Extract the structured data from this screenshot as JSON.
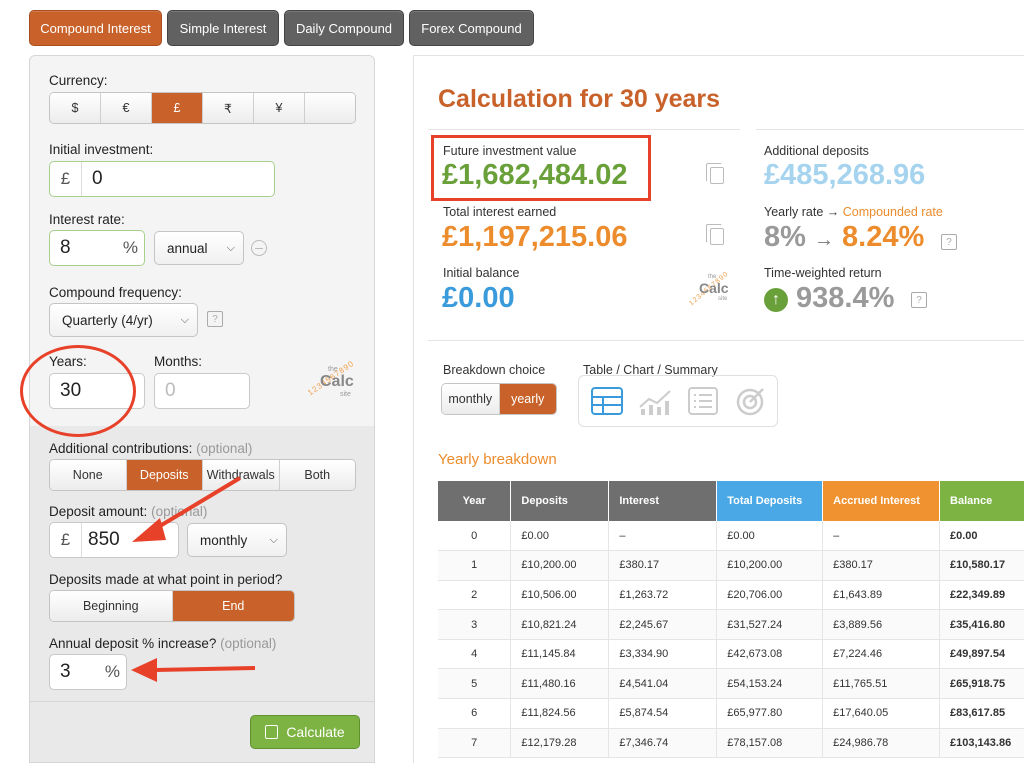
{
  "tabs": [
    {
      "label": "Compound Interest",
      "active": true
    },
    {
      "label": "Simple Interest",
      "active": false
    },
    {
      "label": "Daily Compound",
      "active": false
    },
    {
      "label": "Forex Compound",
      "active": false
    }
  ],
  "form": {
    "currency_label": "Currency:",
    "currencies": [
      "$",
      "€",
      "£",
      "₹",
      "¥",
      ""
    ],
    "currency_selected": "£",
    "initial_label": "Initial investment:",
    "initial_prefix": "£",
    "initial_value": "0",
    "rate_label": "Interest rate:",
    "rate_value": "8",
    "rate_unit": "%",
    "rate_period": "annual",
    "freq_label": "Compound frequency:",
    "freq_value": "Quarterly (4/yr)",
    "years_label": "Years:",
    "years_value": "30",
    "months_label": "Months:",
    "months_placeholder": "0",
    "contrib_label": "Additional contributions:",
    "contrib_optional": "(optional)",
    "contrib_options": [
      "None",
      "Deposits",
      "Withdrawals",
      "Both"
    ],
    "contrib_selected": "Deposits",
    "deposit_label": "Deposit amount:",
    "deposit_optional": "(optional)",
    "deposit_prefix": "£",
    "deposit_value": "850",
    "deposit_period": "monthly",
    "timing_label": "Deposits made at what point in period?",
    "timing_options": [
      "Beginning",
      "End"
    ],
    "timing_selected": "End",
    "increase_label": "Annual deposit % increase?",
    "increase_optional": "(optional)",
    "increase_value": "3",
    "increase_unit": "%",
    "calculate_label": "Calculate",
    "qmark": "?"
  },
  "logo": {
    "the": "the",
    "calc": "Calc",
    "site": "site",
    "digits": "1234567890"
  },
  "results": {
    "title": "Calculation for 30 years",
    "future_label": "Future investment value",
    "future_value": "£1,682,484.02",
    "interest_label": "Total interest earned",
    "interest_value": "£1,197,215.06",
    "initial_label": "Initial balance",
    "initial_value": "£0.00",
    "deposits_label": "Additional deposits",
    "deposits_value": "£485,268.96",
    "yearly_rate_label": "Yearly rate →",
    "compounded_label": "Compounded rate",
    "yearly_rate_value": "8%",
    "arrow": "→",
    "compounded_value": "8.24%",
    "twr_label": "Time-weighted return",
    "twr_value": "938.4%",
    "qmark": "?"
  },
  "breakdown": {
    "choice_label": "Breakdown choice",
    "options": [
      "monthly",
      "yearly"
    ],
    "selected": "yearly",
    "view_label": "Table / Chart / Summary",
    "section_title": "Yearly breakdown"
  },
  "table": {
    "headers": [
      "Year",
      "Deposits",
      "Interest",
      "Total Deposits",
      "Accrued Interest",
      "Balance"
    ],
    "header_colors": [
      "#6f6f6f",
      "#6f6f6f",
      "#6f6f6f",
      "#4aa8e6",
      "#ef922f",
      "#7cb342"
    ],
    "rows": [
      [
        "0",
        "£0.00",
        "–",
        "£0.00",
        "–",
        "£0.00"
      ],
      [
        "1",
        "£10,200.00",
        "£380.17",
        "£10,200.00",
        "£380.17",
        "£10,580.17"
      ],
      [
        "2",
        "£10,506.00",
        "£1,263.72",
        "£20,706.00",
        "£1,643.89",
        "£22,349.89"
      ],
      [
        "3",
        "£10,821.24",
        "£2,245.67",
        "£31,527.24",
        "£3,889.56",
        "£35,416.80"
      ],
      [
        "4",
        "£11,145.84",
        "£3,334.90",
        "£42,673.08",
        "£7,224.46",
        "£49,897.54"
      ],
      [
        "5",
        "£11,480.16",
        "£4,541.04",
        "£54,153.24",
        "£11,765.51",
        "£65,918.75"
      ],
      [
        "6",
        "£11,824.56",
        "£5,874.54",
        "£65,977.80",
        "£17,640.05",
        "£83,617.85"
      ],
      [
        "7",
        "£12,179.28",
        "£7,346.74",
        "£78,157.08",
        "£24,986.78",
        "£103,143.86"
      ]
    ]
  },
  "colors": {
    "accent": "#c8622a",
    "annotation": "#e8412a",
    "calc_button": "#7cb342"
  }
}
